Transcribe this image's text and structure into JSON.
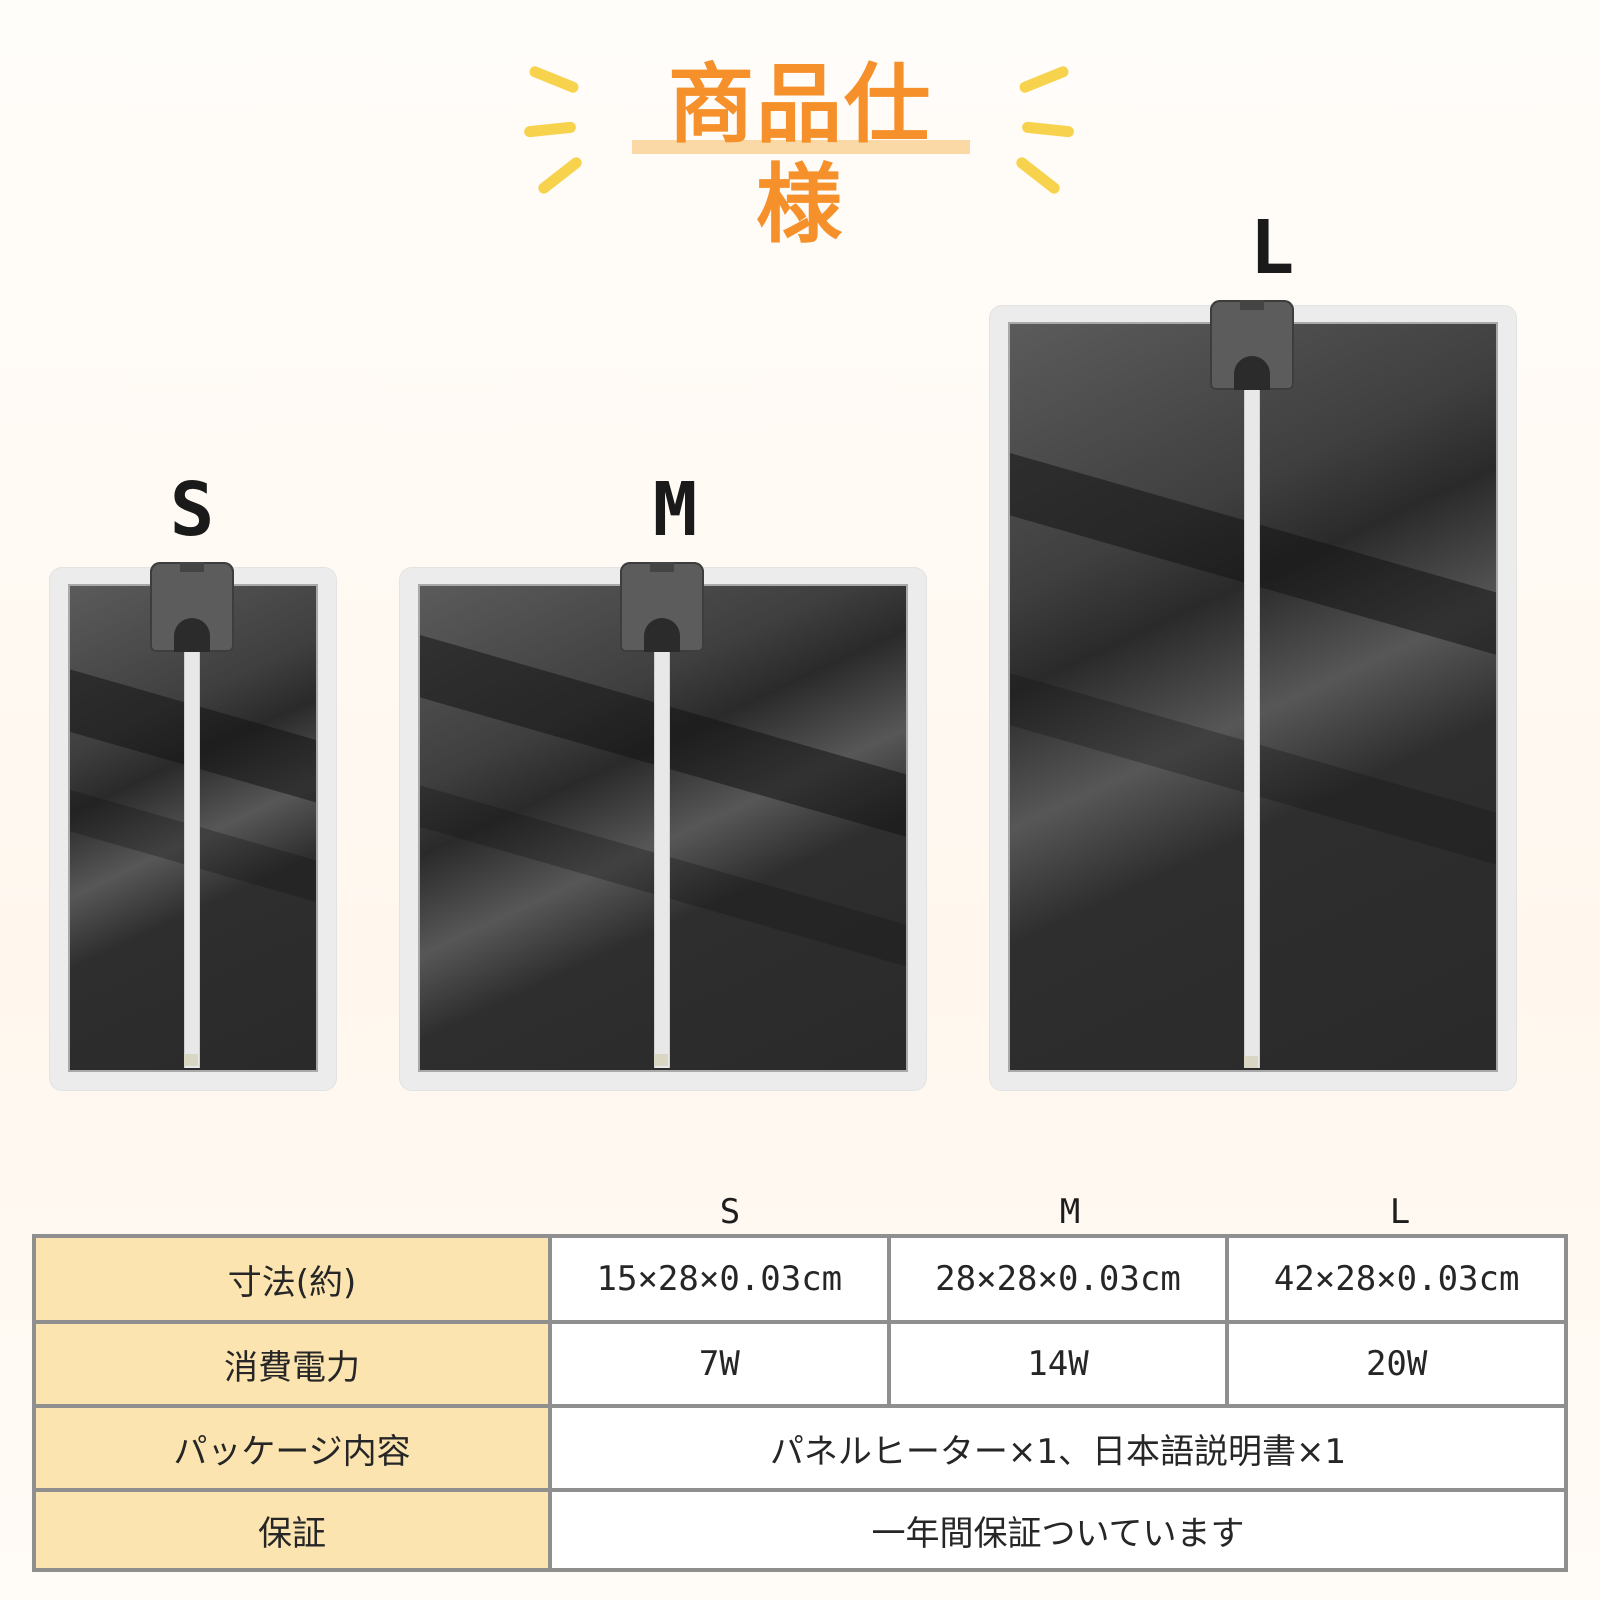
{
  "header": {
    "title": "商品仕様"
  },
  "sizes": {
    "s": {
      "label": "S"
    },
    "m": {
      "label": "M"
    },
    "l": {
      "label": "L"
    }
  },
  "spec_table": {
    "columns": [
      "S",
      "M",
      "L"
    ],
    "rows": [
      {
        "label": "寸法(約)",
        "values": [
          "15×28×0.03cm",
          "28×28×0.03cm",
          "42×28×0.03cm"
        ]
      },
      {
        "label": "消費電力",
        "values": [
          "7W",
          "14W",
          "20W"
        ]
      },
      {
        "label": "パッケージ内容",
        "value": "パネルヒーター×1、日本語説明書×1"
      },
      {
        "label": "保証",
        "value": "一年間保証ついています"
      }
    ]
  },
  "colors": {
    "title": "#f5902a",
    "row_header_bg": "#fbe4b0",
    "burst": "#f7d24d"
  }
}
